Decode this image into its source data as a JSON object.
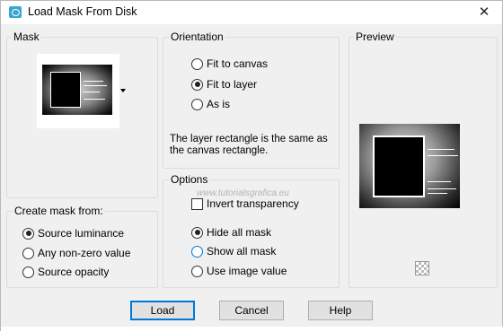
{
  "window": {
    "title": "Load Mask From Disk",
    "close_label": "✕"
  },
  "mask_group": {
    "title": "Mask"
  },
  "create_from_group": {
    "title": "Create mask from:",
    "options": [
      {
        "label": "Source luminance",
        "checked": true
      },
      {
        "label": "Any non-zero value",
        "checked": false
      },
      {
        "label": "Source opacity",
        "checked": false
      }
    ]
  },
  "orientation_group": {
    "title": "Orientation",
    "options": [
      {
        "label": "Fit to canvas",
        "checked": false
      },
      {
        "label": "Fit to layer",
        "checked": true
      },
      {
        "label": "As is",
        "checked": false
      }
    ],
    "info": "The layer rectangle is the same as the canvas rectangle."
  },
  "options_group": {
    "title": "Options",
    "invert_label": "Invert transparency",
    "invert_checked": false,
    "visibility": [
      {
        "label": "Hide all mask",
        "checked": true
      },
      {
        "label": "Show all mask",
        "checked": false
      },
      {
        "label": "Use image value",
        "checked": false
      }
    ]
  },
  "preview_group": {
    "title": "Preview"
  },
  "watermark": "www.tutorialsgrafica.eu",
  "buttons": {
    "load": "Load",
    "cancel": "Cancel",
    "help": "Help"
  },
  "colors": {
    "accent": "#0078d7",
    "panel": "#f0f0f0"
  },
  "icons": [
    "app-icon",
    "close-icon",
    "dropdown-arrow-icon",
    "checkerboard-icon"
  ]
}
